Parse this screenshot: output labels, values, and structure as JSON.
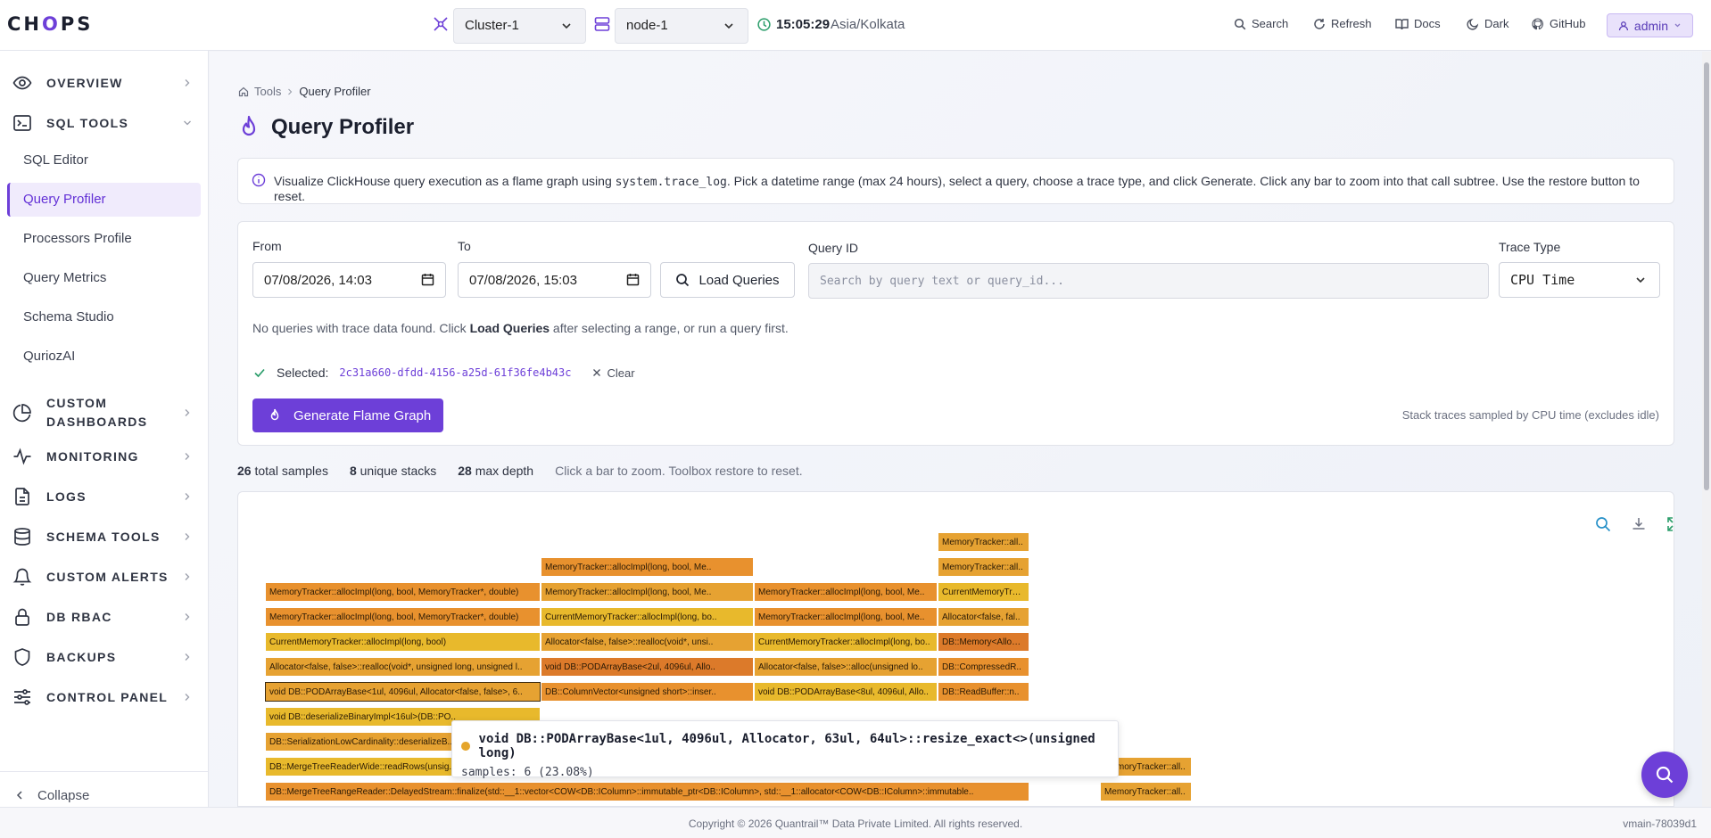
{
  "header": {
    "logo_left": "CH",
    "logo_o": "O",
    "logo_right": "PS",
    "cluster": "Cluster-1",
    "node": "node-1",
    "time": "15:05:29",
    "timezone": "Asia/Kolkata",
    "nav": {
      "search": "Search",
      "refresh": "Refresh",
      "docs": "Docs",
      "dark": "Dark",
      "github": "GitHub"
    },
    "user": "admin"
  },
  "sidebar": {
    "overview": "OVERVIEW",
    "sql_tools": "SQL TOOLS",
    "sub": {
      "sql_editor": "SQL Editor",
      "query_profiler": "Query Profiler",
      "processors_profile": "Processors Profile",
      "query_metrics": "Query Metrics",
      "schema_studio": "Schema Studio",
      "quiroz_ai": "QuriozAI"
    },
    "custom_dashboards_1": "CUSTOM",
    "custom_dashboards_2": "DASHBOARDS",
    "monitoring": "MONITORING",
    "logs": "LOGS",
    "schema_tools": "SCHEMA TOOLS",
    "custom_alerts": "CUSTOM ALERTS",
    "db_rbac": "DB RBAC",
    "backups": "BACKUPS",
    "control_panel": "CONTROL PANEL",
    "collapse": "Collapse"
  },
  "page": {
    "breadcrumb_root": "Tools",
    "breadcrumb_current": "Query Profiler",
    "title": "Query Profiler",
    "info_pre": "Visualize ClickHouse query execution as a flame graph using ",
    "info_code": "system.trace_log",
    "info_post": ". Pick a datetime range (max 24 hours), select a query, choose a trace type, and click Generate. Click any bar to zoom into that call subtree. Use the restore button to reset."
  },
  "form": {
    "from_label": "From",
    "from_value": "07/08/2026, 14:03",
    "to_label": "To",
    "to_value": "07/08/2026, 15:03",
    "load_queries": "Load Queries",
    "query_id_label": "Query ID",
    "query_id_placeholder": "Search by query text or query_id...",
    "trace_type_label": "Trace Type",
    "trace_type_value": "CPU Time",
    "no_queries_pre": "No queries with trace data found. Click ",
    "no_queries_bold": "Load Queries",
    "no_queries_post": " after selecting a range, or run a query first.",
    "selected_label": "Selected:",
    "selected_id": "2c31a660-dfdd-4156-a25d-61f36fe4b43c",
    "clear": "Clear",
    "generate": "Generate Flame Graph",
    "sampled_note": "Stack traces sampled by CPU time (excludes idle)"
  },
  "stats": {
    "total_samples": "26",
    "total_samples_label": "total samples",
    "unique_stacks": "8",
    "unique_stacks_label": "unique stacks",
    "max_depth": "28",
    "max_depth_label": "max depth",
    "hint": "Click a bar to zoom. Toolbox restore to reset."
  },
  "flame": {
    "colors": {
      "orange": "#e8912e",
      "yellow": "#e8b92c",
      "dark_orange": "#dc7a2a",
      "amber": "#e6a232"
    },
    "bars": [
      {
        "label": "MemoryTracker::all..",
        "col": 3,
        "row": 11,
        "color": "#e6a232"
      },
      {
        "label": "MemoryTracker::allocImpl(long, bool, Me..",
        "col": 1,
        "row": 10,
        "color": "#e8912e"
      },
      {
        "label": "MemoryTracker::all..",
        "col": 3,
        "row": 10,
        "color": "#e6a232"
      },
      {
        "label": "MemoryTracker::allocImpl(long, bool, MemoryTracker*, double)",
        "col": 0,
        "row": 9,
        "color": "#e8912e"
      },
      {
        "label": "MemoryTracker::allocImpl(long, bool, Me..",
        "col": 1,
        "row": 9,
        "color": "#e6a232"
      },
      {
        "label": "MemoryTracker::allocImpl(long, bool, Me..",
        "col": 2,
        "row": 9,
        "color": "#e8912e"
      },
      {
        "label": "CurrentMemoryTrac..",
        "col": 3,
        "row": 9,
        "color": "#e8b92c"
      },
      {
        "label": "MemoryTracker::allocImpl(long, bool, MemoryTracker*, double)",
        "col": 0,
        "row": 8,
        "color": "#e8912e"
      },
      {
        "label": "CurrentMemoryTracker::allocImpl(long, bo..",
        "col": 1,
        "row": 8,
        "color": "#e8b92c"
      },
      {
        "label": "MemoryTracker::allocImpl(long, bool, Me..",
        "col": 2,
        "row": 8,
        "color": "#e8912e"
      },
      {
        "label": "Allocator<false, fal..",
        "col": 3,
        "row": 8,
        "color": "#e6a232"
      },
      {
        "label": "CurrentMemoryTracker::allocImpl(long, bool)",
        "col": 0,
        "row": 7,
        "color": "#e8b92c"
      },
      {
        "label": "Allocator<false, false>::realloc(void*, unsi..",
        "col": 1,
        "row": 7,
        "color": "#e6a232"
      },
      {
        "label": "CurrentMemoryTracker::allocImpl(long, bo..",
        "col": 2,
        "row": 7,
        "color": "#e8b92c"
      },
      {
        "label": "DB::Memory<Alloca..",
        "col": 3,
        "row": 7,
        "color": "#dc7a2a"
      },
      {
        "label": "Allocator<false, false>::realloc(void*, unsigned long, unsigned l..",
        "col": 0,
        "row": 6,
        "color": "#e6a232"
      },
      {
        "label": "void DB::PODArrayBase<2ul, 4096ul, Allo..",
        "col": 1,
        "row": 6,
        "color": "#dc7a2a"
      },
      {
        "label": "Allocator<false, false>::alloc(unsigned lo..",
        "col": 2,
        "row": 6,
        "color": "#e6a232"
      },
      {
        "label": "DB::CompressedR..",
        "col": 3,
        "row": 6,
        "color": "#e8912e"
      },
      {
        "label": "void DB::PODArrayBase<1ul, 4096ul, Allocator<false, false>, 6..",
        "col": 0,
        "row": 5,
        "color": "#e6a232",
        "highlight": true
      },
      {
        "label": "DB::ColumnVector<unsigned short>::inser..",
        "col": 1,
        "row": 5,
        "color": "#e8912e"
      },
      {
        "label": "void DB::PODArrayBase<8ul, 4096ul, Allo..",
        "col": 2,
        "row": 5,
        "color": "#e8b92c"
      },
      {
        "label": "DB::ReadBuffer::n..",
        "col": 3,
        "row": 5,
        "color": "#e8912e"
      },
      {
        "label": "void DB::deserializeBinaryImpl<16ul>(DB::PO..",
        "col": 0,
        "row": 4,
        "color": "#e8b92c"
      },
      {
        "label": "DB::SerializationLowCardinality::deserializeB..",
        "col": 0,
        "row": 3,
        "color": "#e6a232"
      },
      {
        "label": "DB::MergeTreeReaderWide::readRows(unsig..",
        "col": 0,
        "row": 2,
        "color": "#e8b92c"
      },
      {
        "label": "DB::MergeTreeRangeReader::DelayedStream::finalize(std::__1::vector<COW<DB::IColumn>::immutable_ptr<DB::IColumn>, std::__1::allocator<COW<DB::IColumn>::immutable..",
        "col": 0,
        "row": 1,
        "color": "#e8912e",
        "wide": true
      },
      {
        "label": "MemoryTracker::all..",
        "col": 4,
        "row": 2,
        "color": "#e6a232"
      },
      {
        "label": "MemoryTracker::all..",
        "col": 4,
        "row": 1,
        "color": "#e6a232"
      }
    ],
    "tooltip_title": "void DB::PODArrayBase<1ul, 4096ul, Allocator, 63ul, 64ul>::resize_exact<>(unsigned long)",
    "tooltip_samples": "samples: 6 (23.08%)"
  },
  "footer": {
    "copyright": "Copyright © 2026 Quantrail™ Data Private Limited. All rights reserved.",
    "version": "vmain-78039d1"
  }
}
